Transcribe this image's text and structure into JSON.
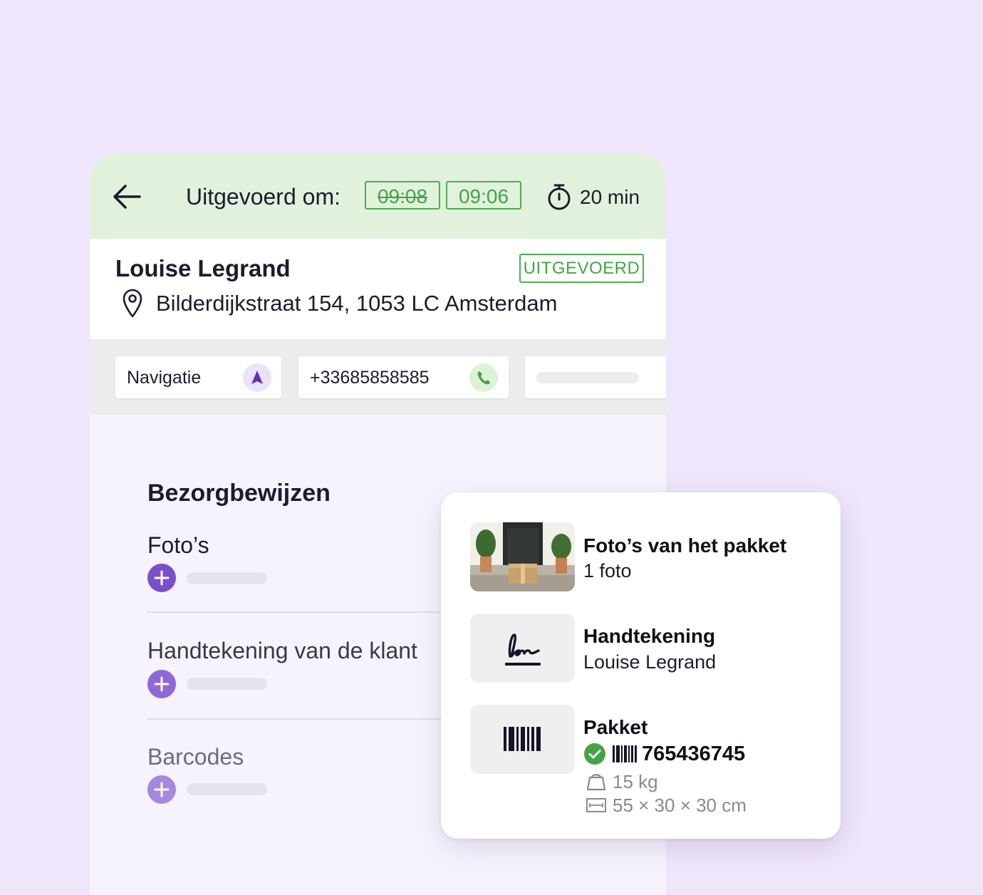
{
  "header": {
    "done_label": "Uitgevoerd om:",
    "time_planned": "09:08",
    "time_actual": "09:06",
    "duration": "20 min"
  },
  "customer": {
    "name": "Louise Legrand",
    "status": "UITGEVOERD",
    "address": "Bilderdijkstraat 154, 1053 LC Amsterdam"
  },
  "actions": {
    "navigation_label": "Navigatie",
    "phone_label": "+33685858585"
  },
  "proofs": {
    "title": "Bezorgbewijzen",
    "items": [
      {
        "label": "Foto’s"
      },
      {
        "label": "Handtekening van de klant"
      },
      {
        "label": "Barcodes"
      }
    ]
  },
  "summary": {
    "photos": {
      "title": "Foto’s van het pakket",
      "subtitle": "1 foto"
    },
    "signature": {
      "title": "Handtekening",
      "subtitle": "Louise Legrand"
    },
    "parcel": {
      "title": "Pakket",
      "barcode": "765436745",
      "weight": "15 kg",
      "dimensions": "55 × 30 × 30 cm"
    }
  },
  "colors": {
    "accent_green": "#4caf50",
    "accent_purple": "#6d3fcf",
    "background": "#efe6fb"
  }
}
